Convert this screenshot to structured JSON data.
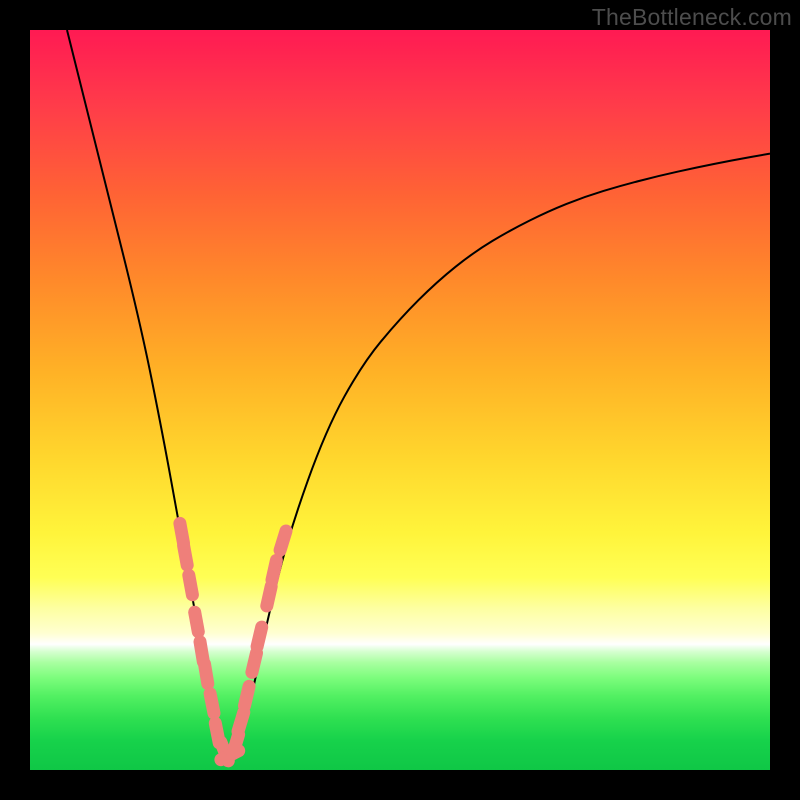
{
  "watermark": "TheBottleneck.com",
  "colors": {
    "frame": "#000000",
    "curve_stroke": "#000000",
    "markers": "#ef7f7a",
    "gradient_top": "#ff1a53",
    "gradient_bottom": "#0fc746"
  },
  "chart_data": {
    "type": "line",
    "title": "",
    "xlabel": "",
    "ylabel": "",
    "xlim": [
      0,
      100
    ],
    "ylim": [
      0,
      100
    ],
    "series": [
      {
        "name": "bottleneck-curve",
        "x": [
          5,
          10,
          15,
          18,
          20,
          22,
          24,
          25,
          26,
          27,
          28,
          30,
          32,
          35,
          40,
          45,
          50,
          55,
          60,
          65,
          70,
          75,
          80,
          85,
          90,
          95,
          100
        ],
        "y": [
          100,
          80,
          60,
          45,
          34,
          23,
          12,
          5,
          2,
          0,
          3,
          10,
          20,
          32,
          46,
          55,
          61,
          66,
          70,
          73,
          75.5,
          77.5,
          79,
          80.3,
          81.4,
          82.4,
          83.3
        ]
      }
    ],
    "markers": {
      "name": "highlight-points",
      "points": [
        {
          "x": 20.5,
          "y": 32
        },
        {
          "x": 21.0,
          "y": 29
        },
        {
          "x": 21.7,
          "y": 25
        },
        {
          "x": 22.5,
          "y": 20
        },
        {
          "x": 23.2,
          "y": 16
        },
        {
          "x": 23.8,
          "y": 13
        },
        {
          "x": 24.6,
          "y": 9
        },
        {
          "x": 25.3,
          "y": 5
        },
        {
          "x": 26.3,
          "y": 2.5
        },
        {
          "x": 27.0,
          "y": 2
        },
        {
          "x": 27.8,
          "y": 3.5
        },
        {
          "x": 28.5,
          "y": 6.5
        },
        {
          "x": 29.3,
          "y": 10
        },
        {
          "x": 30.3,
          "y": 14.5
        },
        {
          "x": 31.0,
          "y": 18
        },
        {
          "x": 32.3,
          "y": 23.5
        },
        {
          "x": 33.0,
          "y": 27
        },
        {
          "x": 34.2,
          "y": 31
        }
      ]
    }
  }
}
